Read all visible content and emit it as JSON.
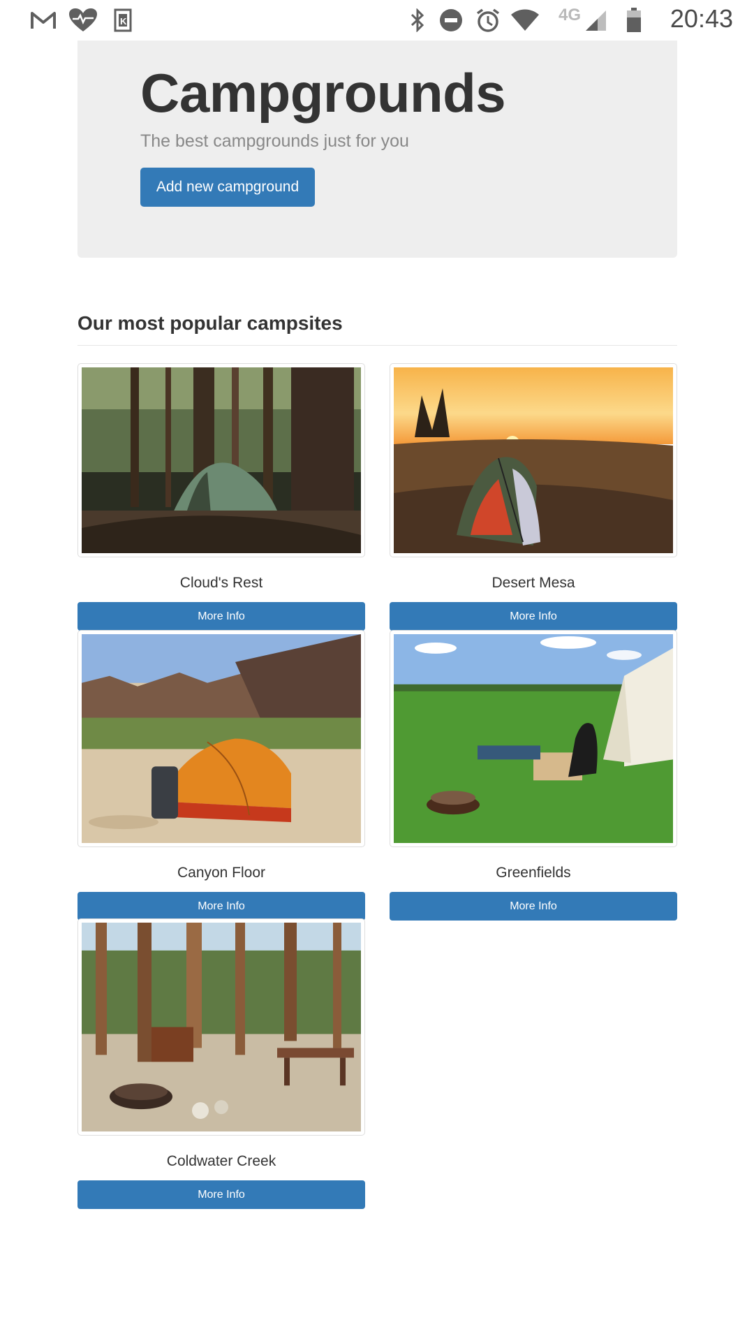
{
  "status_bar": {
    "time": "20:43",
    "network": "4G",
    "icons": [
      "gmail-icon",
      "health-icon",
      "kindle-icon",
      "bluetooth-icon",
      "do-not-disturb-icon",
      "alarm-icon",
      "wifi-icon",
      "cell-signal-icon",
      "battery-icon"
    ]
  },
  "jumbotron": {
    "title": "Campgrounds",
    "subtitle": "The best campgrounds just for you",
    "add_button": "Add new campground"
  },
  "section": {
    "title": "Our most popular campsites"
  },
  "campgrounds": [
    {
      "name": "Cloud's Rest",
      "button": "More Info",
      "image": "tent-in-dark-forest"
    },
    {
      "name": "Desert Mesa",
      "button": "More Info",
      "image": "tent-at-sunset-prairie"
    },
    {
      "name": "Canyon Floor",
      "button": "More Info",
      "image": "orange-tent-in-canyon"
    },
    {
      "name": "Greenfields",
      "button": "More Info",
      "image": "campers-on-green-field"
    },
    {
      "name": "Coldwater Creek",
      "button": "More Info",
      "image": "campsite-in-pine-forest"
    }
  ],
  "colors": {
    "primary": "#337ab7",
    "jumbotron_bg": "#eeeeee"
  }
}
